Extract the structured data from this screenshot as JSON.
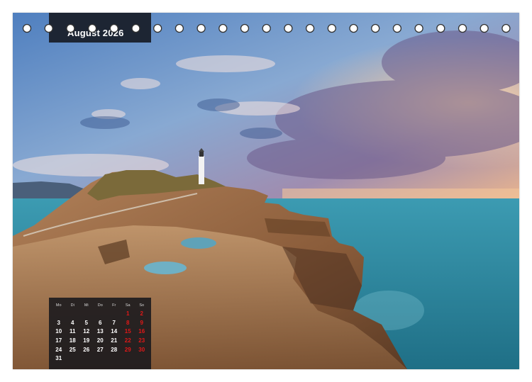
{
  "calendar": {
    "month_label": "August 2026",
    "weekdays": [
      "Mo",
      "Di",
      "Mi",
      "Do",
      "Fr",
      "Sa",
      "So"
    ],
    "weeks": [
      [
        "",
        "",
        "",
        "",
        "",
        "1",
        "2"
      ],
      [
        "3",
        "4",
        "5",
        "6",
        "7",
        "8",
        "9"
      ],
      [
        "10",
        "11",
        "12",
        "13",
        "14",
        "15",
        "16"
      ],
      [
        "17",
        "18",
        "19",
        "20",
        "21",
        "22",
        "23"
      ],
      [
        "24",
        "25",
        "26",
        "27",
        "28",
        "29",
        "30"
      ],
      [
        "31",
        "",
        "",
        "",
        "",
        "",
        ""
      ]
    ]
  },
  "photo": {
    "subject": "lighthouse on coastal rock headland at sunset",
    "colors": {
      "sky_top": "#4e78b4",
      "sky_sunset": "#f3b08a",
      "cloud_purple": "#7a6a9a",
      "sea": "#2f8fa6",
      "rock": "#9a6a42"
    }
  },
  "colors": {
    "month_box": "#1d2533",
    "weekend": "#e01818"
  }
}
